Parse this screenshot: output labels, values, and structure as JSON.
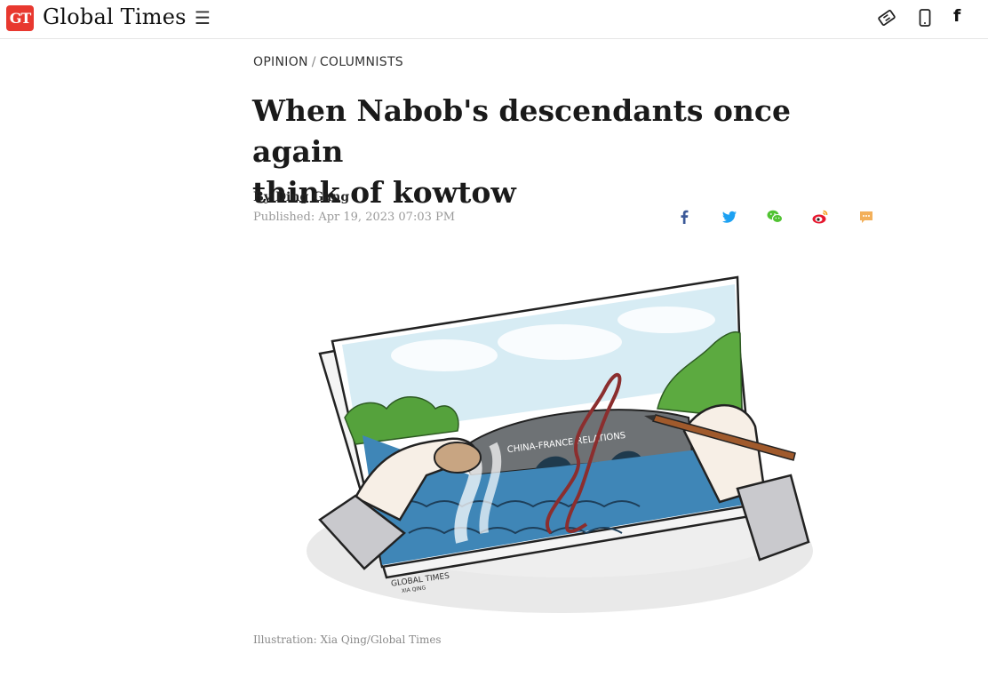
{
  "header": {
    "logo_badge": "GT",
    "site_name": "Global Times",
    "menu_icon": "hamburger-icon",
    "right_icons": [
      "tag-icon",
      "mobile-icon",
      "facebook-icon"
    ],
    "fb_glyph": "f"
  },
  "article": {
    "breadcrumb": {
      "section": "OPINION",
      "separator": "/",
      "subsection": "COLUMNISTS"
    },
    "title_line1": "When Nabob's descendants once again",
    "title_line2": "think of kowtow",
    "byline": "By Ding Gang",
    "published": "Published: Apr 19, 2023 07:03 PM",
    "share_icons": [
      "facebook-share-icon",
      "twitter-share-icon",
      "wechat-share-icon",
      "weibo-share-icon",
      "comment-icon"
    ],
    "share_colors": {
      "facebook": "#3b5998",
      "twitter": "#1da1f2",
      "wechat": "#51c332",
      "weibo": "#e6162d",
      "comment": "#f3b05a"
    },
    "image": {
      "bridge_label": "CHINA-FRANCE RELATIONS",
      "signature": "GLOBAL TIMES",
      "signature_sub": "XIA QING"
    },
    "caption": "Illustration: Xia Qing/Global Times"
  }
}
